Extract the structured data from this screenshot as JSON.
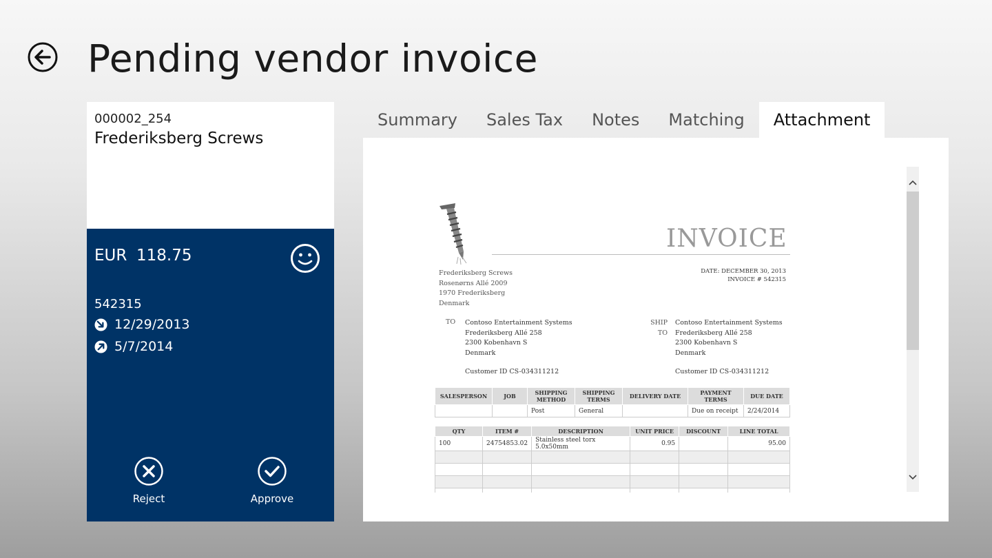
{
  "header": {
    "title": "Pending vendor invoice"
  },
  "invoice_card": {
    "id": "000002_254",
    "vendor": "Frederiksberg Screws",
    "currency": "EUR",
    "amount": "118.75",
    "invoice_number": "542315",
    "invoice_date": "12/29/2013",
    "due_date": "5/7/2014",
    "reject_label": "Reject",
    "approve_label": "Approve"
  },
  "tabs": [
    {
      "label": "Summary",
      "active": false
    },
    {
      "label": "Sales Tax",
      "active": false
    },
    {
      "label": "Notes",
      "active": false
    },
    {
      "label": "Matching",
      "active": false
    },
    {
      "label": "Attachment",
      "active": true
    }
  ],
  "attachment": {
    "title": "INVOICE",
    "from": [
      "Frederiksberg Screws",
      "Rosenørns Allé 2009",
      "1970 Frederiksberg",
      "Denmark"
    ],
    "date_line": "DATE: DECEMBER 30, 2013",
    "invoice_line": "INVOICE # 542315",
    "to_label": "TO",
    "ship_label_1": "SHIP",
    "ship_label_2": "TO",
    "to_address": [
      "Contoso Entertainment Systems",
      "Frederiksberg Allé 258",
      "2300 Kobenhavn S",
      "Denmark"
    ],
    "ship_address": [
      "Contoso Entertainment Systems",
      "Frederiksberg Allé 258",
      "2300 Kobenhavn S",
      "Denmark"
    ],
    "customer_id_to": "Customer ID CS-034311212",
    "customer_id_ship": "Customer ID CS-034311212",
    "order_table": {
      "headers": [
        "SALESPERSON",
        "JOB",
        "SHIPPING METHOD",
        "SHIPPING TERMS",
        "DELIVERY DATE",
        "PAYMENT TERMS",
        "DUE DATE"
      ],
      "row": [
        "",
        "",
        "Post",
        "General",
        "",
        "Due on receipt",
        "2/24/2014"
      ]
    },
    "items_table": {
      "headers": [
        "QTY",
        "ITEM #",
        "DESCRIPTION",
        "UNIT PRICE",
        "DISCOUNT",
        "LINE TOTAL"
      ],
      "rows": [
        [
          "100",
          "24754853.02",
          "Stainless steel torx 5.0x50mm",
          "0.95",
          "",
          "95.00"
        ]
      ]
    }
  },
  "colors": {
    "card_blue": "#003366",
    "active_tab": "#ffffff",
    "invoice_title": "#999999"
  }
}
